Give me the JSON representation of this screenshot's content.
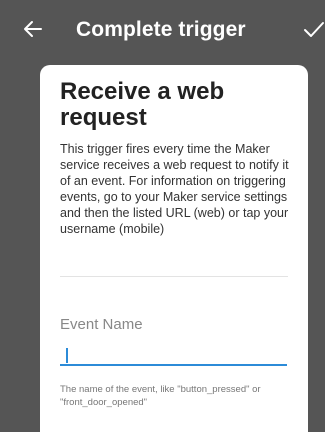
{
  "header": {
    "title": "Complete trigger",
    "back_icon": "arrow-left-icon",
    "confirm_icon": "checkmark-icon"
  },
  "card": {
    "title": "Receive a web request",
    "description": "This trigger fires every time the Maker service receives a web request to notify it of an event. For information on triggering events, go to your Maker service settings and then the listed URL (web) or tap your username (mobile)"
  },
  "event_field": {
    "label": "Event Name",
    "value": "",
    "help_text": "The name of the event, like \"button_pressed\" or \"front_door_opened\""
  },
  "colors": {
    "background": "#555555",
    "card": "#ffffff",
    "accent": "#2c8bd8"
  }
}
